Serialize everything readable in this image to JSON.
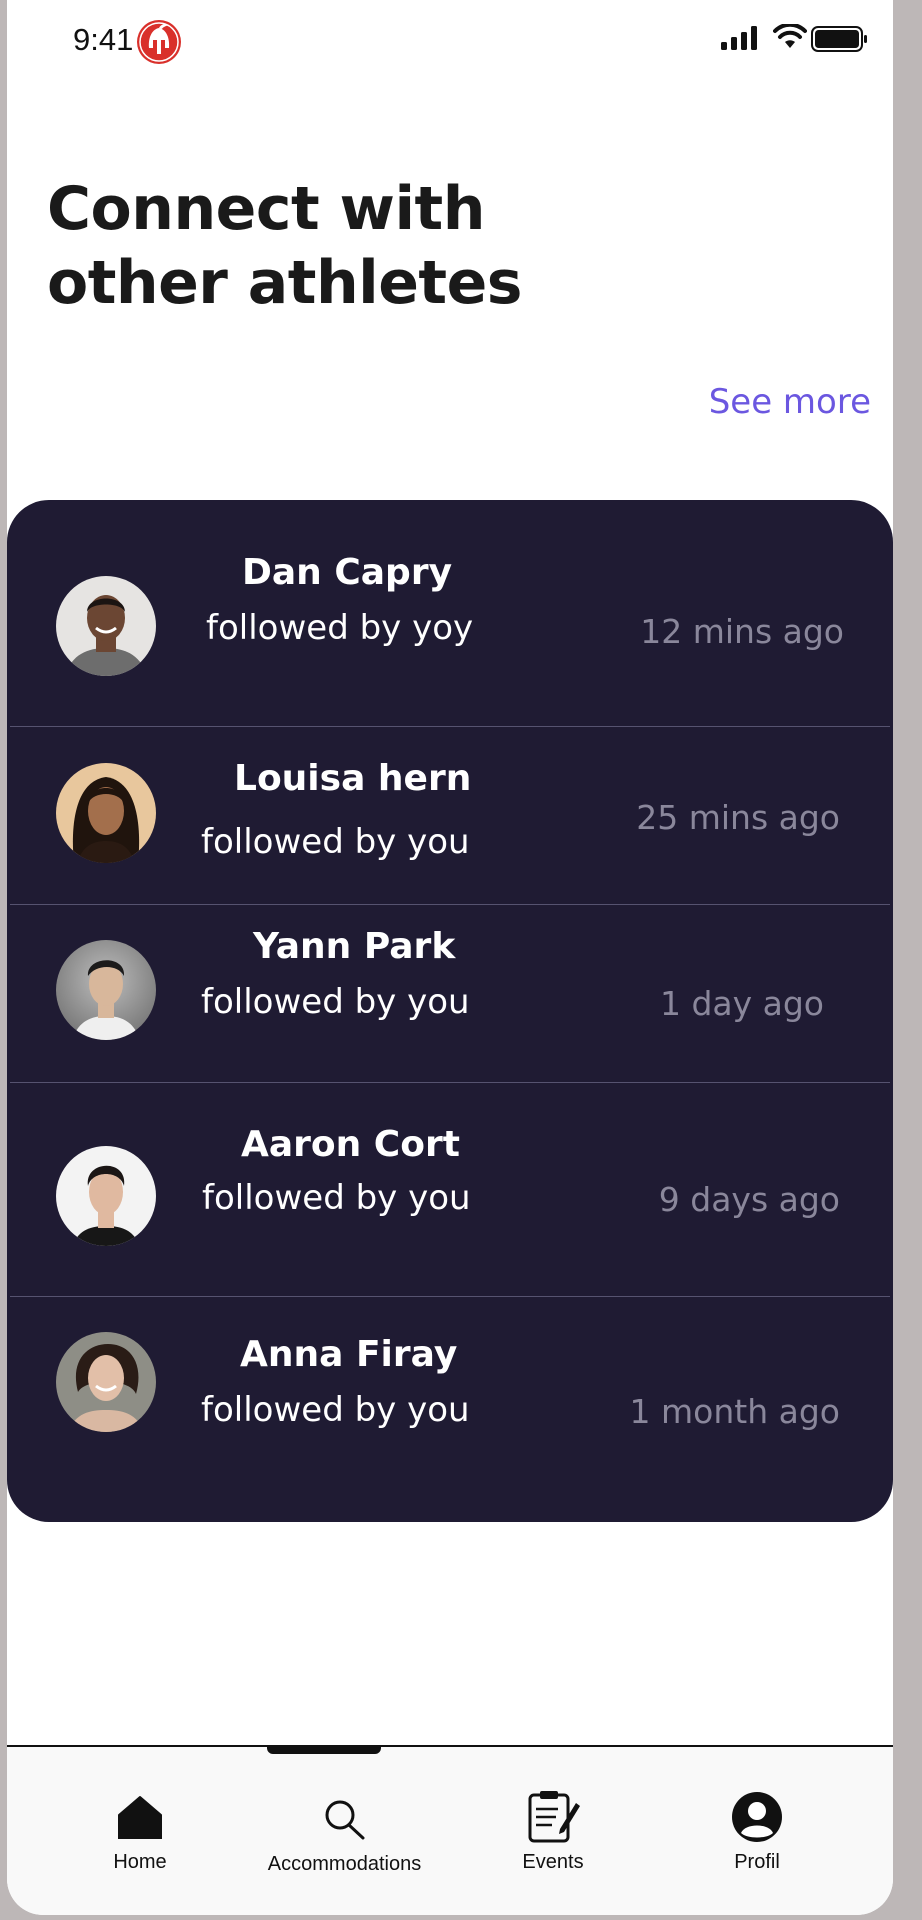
{
  "status_bar": {
    "time": "9:41"
  },
  "header": {
    "title_line1": "Connect with",
    "title_line2": "other athletes",
    "see_more": "See more"
  },
  "athletes": [
    {
      "name": "Dan Capry",
      "status": "followed by yoy",
      "time": "12 mins ago",
      "avatar_bg": "#e6e4e2",
      "skin": "#6b4633",
      "hair": "#1b1412",
      "shirt": "#6d6d6d"
    },
    {
      "name": "Louisa hern",
      "status": "followed by you",
      "time": "25 mins ago",
      "avatar_bg": "#e8c79d",
      "skin": "#a36f4c",
      "hair": "#20140d",
      "shirt": "#2a1a12"
    },
    {
      "name": "Yann Park",
      "status": "followed by you",
      "time": "1 day ago",
      "avatar_bg": "#8a8a8a",
      "skin": "#d8b79b",
      "hair": "#1c1b1b",
      "shirt": "#efefef"
    },
    {
      "name": "Aaron Cort",
      "status": "followed by you",
      "time": "9 days ago",
      "avatar_bg": "#f3f3f3",
      "skin": "#e0b9a0",
      "hair": "#1b1615",
      "shirt": "#171717"
    },
    {
      "name": "Anna Firay",
      "status": "followed by you",
      "time": "1 month ago",
      "avatar_bg": "#8e8e86",
      "skin": "#e2bfa8",
      "hair": "#2a1c16",
      "shirt": "#d9b8a2"
    }
  ],
  "nav": {
    "home": "Home",
    "accommodations": "Accommodations",
    "events": "Events",
    "profile": "Profil"
  },
  "colors": {
    "card_bg": "#1f1b33",
    "accent": "#6b57e0",
    "time_text": "#8a879b",
    "logo_red": "#d9302b"
  },
  "icons": {
    "logo": "spartan-helmet-icon",
    "home": "home-icon",
    "accommodations": "search-icon",
    "events": "clipboard-icon",
    "profile": "user-circle-icon"
  }
}
